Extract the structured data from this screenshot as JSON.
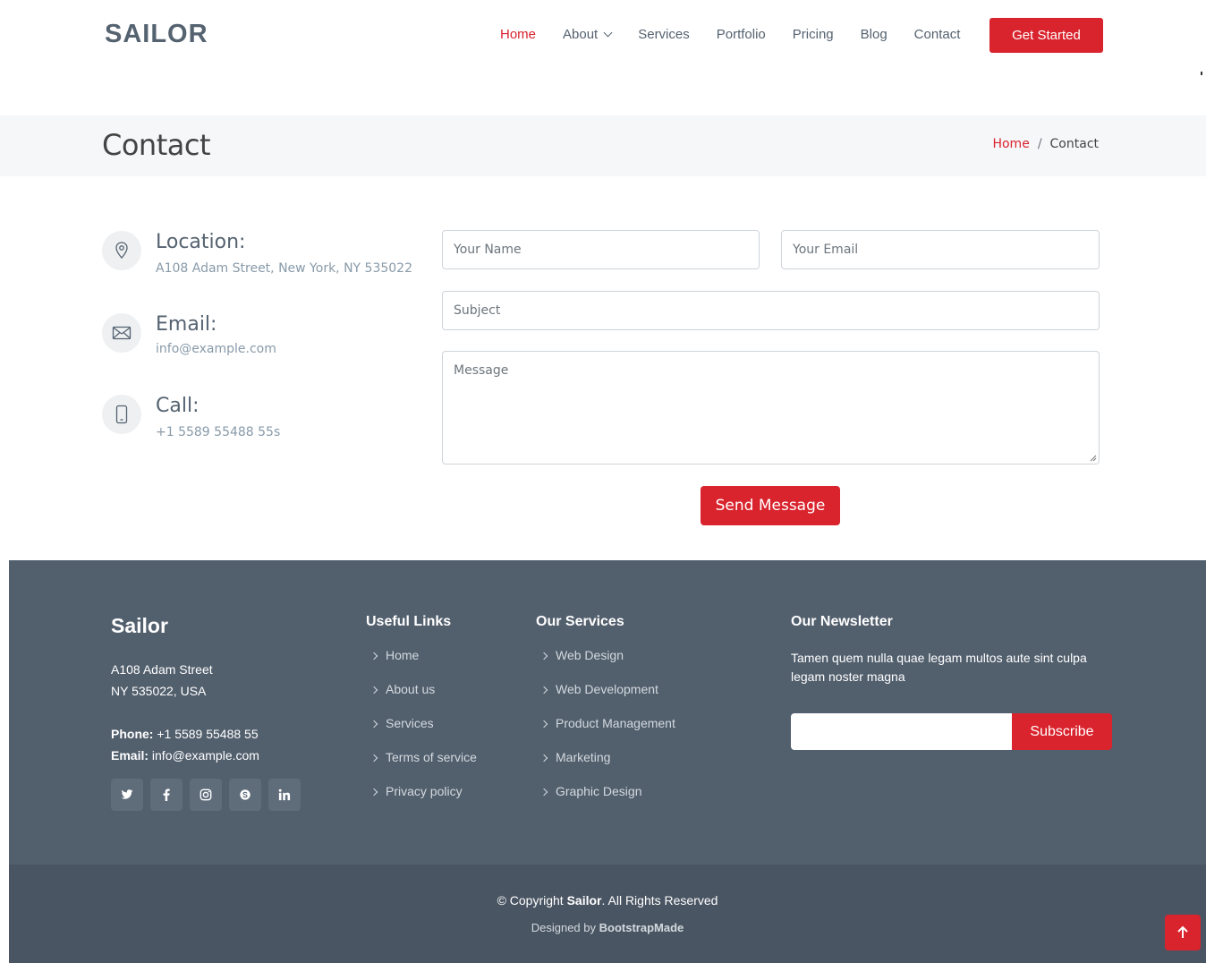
{
  "header": {
    "logo": "SAILOR",
    "nav": [
      {
        "label": "Home",
        "active": true
      },
      {
        "label": "About",
        "dropdown": true
      },
      {
        "label": "Services"
      },
      {
        "label": "Portfolio"
      },
      {
        "label": "Pricing"
      },
      {
        "label": "Blog"
      },
      {
        "label": "Contact"
      }
    ],
    "cta_label": "Get Started"
  },
  "breadcrumbs": {
    "page_title": "Contact",
    "home": "Home",
    "separator": "/",
    "current": "Contact"
  },
  "contact_info": {
    "location_title": "Location:",
    "location_text": "A108 Adam Street, New York, NY 535022",
    "email_title": "Email:",
    "email_text": "info@example.com",
    "call_title": "Call:",
    "call_text": "+1 5589 55488 55s"
  },
  "form": {
    "name_placeholder": "Your Name",
    "email_placeholder": "Your Email",
    "subject_placeholder": "Subject",
    "message_placeholder": "Message",
    "submit_label": "Send Message"
  },
  "footer": {
    "brand": "Sailor",
    "address_line1": "A108 Adam Street",
    "address_line2": "NY 535022, USA",
    "phone_label": "Phone:",
    "phone": "+1 5589 55488 55",
    "email_label": "Email:",
    "email": "info@example.com",
    "social": [
      "twitter-icon",
      "facebook-icon",
      "instagram-icon",
      "skype-icon",
      "linkedin-icon"
    ],
    "useful_links_title": "Useful Links",
    "useful_links": [
      "Home",
      "About us",
      "Services",
      "Terms of service",
      "Privacy policy"
    ],
    "services_title": "Our Services",
    "services": [
      "Web Design",
      "Web Development",
      "Product Management",
      "Marketing",
      "Graphic Design"
    ],
    "newsletter_title": "Our Newsletter",
    "newsletter_text": "Tamen quem nulla quae legam multos aute sint culpa legam noster magna",
    "newsletter_input_value": "",
    "subscribe_label": "Subscribe"
  },
  "copyright": {
    "prefix": "© Copyright",
    "brand": "Sailor",
    "suffix": ". All Rights Reserved",
    "designed_by": "Designed by",
    "designer": "BootstrapMade"
  },
  "colors": {
    "accent": "#d9232d",
    "footer_bg": "#525f6d",
    "footer_bottom_bg": "#4a5563",
    "text": "#556270"
  }
}
